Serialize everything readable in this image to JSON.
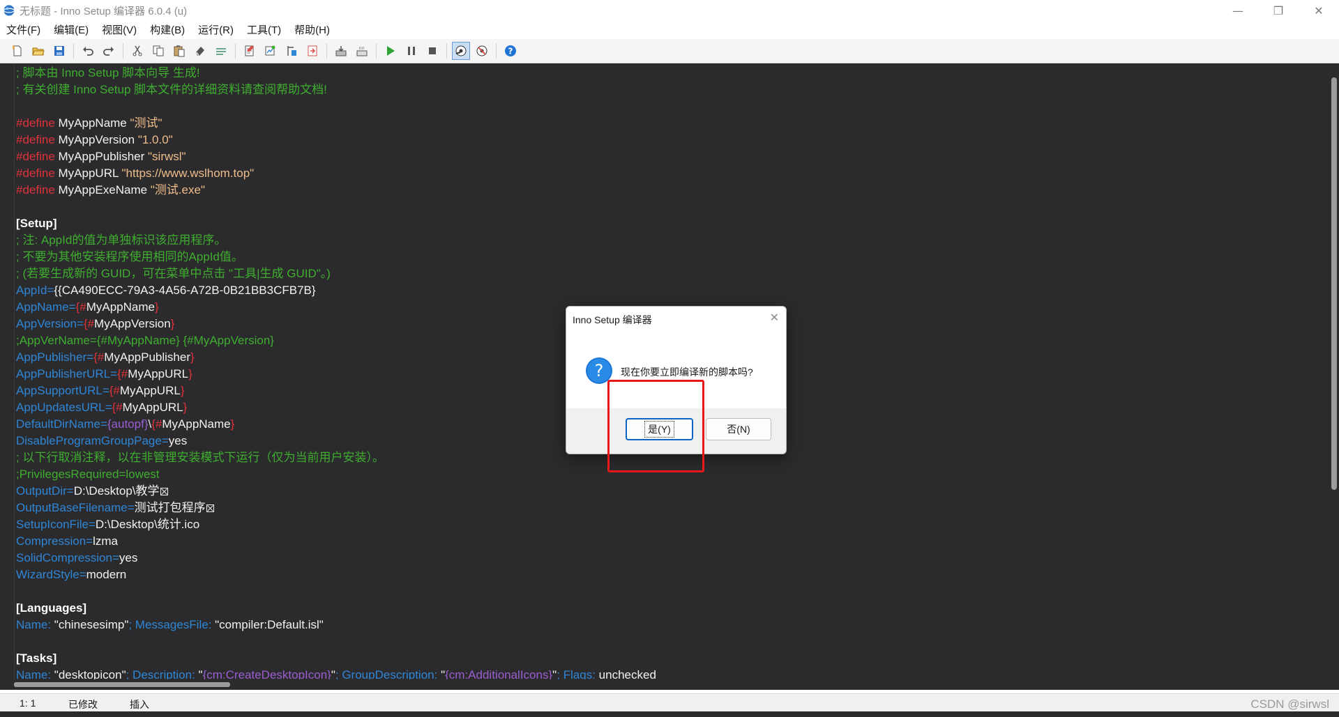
{
  "window": {
    "title": "无标题 - Inno Setup 编译器 6.0.4 (u)",
    "minimize_glyph": "—",
    "restore_glyph": "❐",
    "close_glyph": "✕"
  },
  "menu": [
    "文件(F)",
    "编辑(E)",
    "视图(V)",
    "构建(B)",
    "运行(R)",
    "工具(T)",
    "帮助(H)"
  ],
  "toolbar": {
    "icons": [
      "new-file-icon",
      "open-file-icon",
      "save-icon",
      "undo-icon",
      "redo-icon",
      "cut-icon",
      "copy-icon",
      "paste-icon",
      "erase-icon",
      "find-icon",
      "find-in-files-icon",
      "replace-icon",
      "goto-icon",
      "stop-icon",
      "compile-icon",
      "compile-all-icon",
      "run-icon",
      "pause-icon",
      "stop-run-icon",
      "target-setup-icon",
      "target-uninstall-icon",
      "help-icon"
    ]
  },
  "editor": {
    "lines": [
      [
        {
          "c": "cm",
          "t": "; 脚本由 Inno Setup 脚本向导 生成!"
        }
      ],
      [
        {
          "c": "cm",
          "t": "; 有关创建 Inno Setup 脚本文件的详细资料请查阅帮助文档!"
        }
      ],
      [],
      [
        {
          "c": "pp",
          "t": "#define"
        },
        {
          "c": "tx",
          "t": " MyAppName "
        },
        {
          "c": "nb",
          "t": "\"测试\""
        }
      ],
      [
        {
          "c": "pp",
          "t": "#define"
        },
        {
          "c": "tx",
          "t": " MyAppVersion "
        },
        {
          "c": "nb",
          "t": "\"1.0.0\""
        }
      ],
      [
        {
          "c": "pp",
          "t": "#define"
        },
        {
          "c": "tx",
          "t": " MyAppPublisher "
        },
        {
          "c": "nb",
          "t": "\"sirwsl\""
        }
      ],
      [
        {
          "c": "pp",
          "t": "#define"
        },
        {
          "c": "tx",
          "t": " MyAppURL "
        },
        {
          "c": "nb",
          "t": "\"https://www.wslhom.top\""
        }
      ],
      [
        {
          "c": "pp",
          "t": "#define"
        },
        {
          "c": "tx",
          "t": " MyAppExeName "
        },
        {
          "c": "nb",
          "t": "\"测试.exe\""
        }
      ],
      [],
      [
        {
          "c": "hd",
          "t": "[Setup]"
        }
      ],
      [
        {
          "c": "cm",
          "t": "; 注: AppId的值为单独标识该应用程序。"
        }
      ],
      [
        {
          "c": "cm",
          "t": "; 不要为其他安装程序使用相同的AppId值。"
        }
      ],
      [
        {
          "c": "cm",
          "t": "; (若要生成新的 GUID，可在菜单中点击 \"工具|生成 GUID\"。)"
        }
      ],
      [
        {
          "c": "kw",
          "t": "AppId"
        },
        {
          "c": "op",
          "t": "="
        },
        {
          "c": "vv",
          "t": "{{CA490ECC-79A3-4A56-A72B-0B21BB3CFB7B}"
        }
      ],
      [
        {
          "c": "kw",
          "t": "AppName"
        },
        {
          "c": "op",
          "t": "="
        },
        {
          "c": "br",
          "t": "{#"
        },
        {
          "c": "vv",
          "t": "MyAppName"
        },
        {
          "c": "br",
          "t": "}"
        }
      ],
      [
        {
          "c": "kw",
          "t": "AppVersion"
        },
        {
          "c": "op",
          "t": "="
        },
        {
          "c": "br",
          "t": "{#"
        },
        {
          "c": "vv",
          "t": "MyAppVersion"
        },
        {
          "c": "br",
          "t": "}"
        }
      ],
      [
        {
          "c": "cm",
          "t": ";AppVerName={#MyAppName} {#MyAppVersion}"
        }
      ],
      [
        {
          "c": "kw",
          "t": "AppPublisher"
        },
        {
          "c": "op",
          "t": "="
        },
        {
          "c": "br",
          "t": "{#"
        },
        {
          "c": "vv",
          "t": "MyAppPublisher"
        },
        {
          "c": "br",
          "t": "}"
        }
      ],
      [
        {
          "c": "kw",
          "t": "AppPublisherURL"
        },
        {
          "c": "op",
          "t": "="
        },
        {
          "c": "br",
          "t": "{#"
        },
        {
          "c": "vv",
          "t": "MyAppURL"
        },
        {
          "c": "br",
          "t": "}"
        }
      ],
      [
        {
          "c": "kw",
          "t": "AppSupportURL"
        },
        {
          "c": "op",
          "t": "="
        },
        {
          "c": "br",
          "t": "{#"
        },
        {
          "c": "vv",
          "t": "MyAppURL"
        },
        {
          "c": "br",
          "t": "}"
        }
      ],
      [
        {
          "c": "kw",
          "t": "AppUpdatesURL"
        },
        {
          "c": "op",
          "t": "="
        },
        {
          "c": "br",
          "t": "{#"
        },
        {
          "c": "vv",
          "t": "MyAppURL"
        },
        {
          "c": "br",
          "t": "}"
        }
      ],
      [
        {
          "c": "kw",
          "t": "DefaultDirName"
        },
        {
          "c": "op",
          "t": "="
        },
        {
          "c": "pu",
          "t": "{autopf}"
        },
        {
          "c": "vv",
          "t": "\\"
        },
        {
          "c": "br",
          "t": "{#"
        },
        {
          "c": "vv",
          "t": "MyAppName"
        },
        {
          "c": "br",
          "t": "}"
        }
      ],
      [
        {
          "c": "kw",
          "t": "DisableProgramGroupPage"
        },
        {
          "c": "op",
          "t": "="
        },
        {
          "c": "vv",
          "t": "yes"
        }
      ],
      [
        {
          "c": "cm",
          "t": "; 以下行取消注释，以在非管理安装模式下运行（仅为当前用户安装）。"
        }
      ],
      [
        {
          "c": "cm",
          "t": ";PrivilegesRequired=lowest"
        }
      ],
      [
        {
          "c": "kw",
          "t": "OutputDir"
        },
        {
          "c": "op",
          "t": "="
        },
        {
          "c": "vv",
          "t": "D:\\Desktop\\教学"
        },
        {
          "c": "box",
          "t": ""
        }
      ],
      [
        {
          "c": "kw",
          "t": "OutputBaseFilename"
        },
        {
          "c": "op",
          "t": "="
        },
        {
          "c": "vv",
          "t": "测试打包程序"
        },
        {
          "c": "box",
          "t": ""
        }
      ],
      [
        {
          "c": "kw",
          "t": "SetupIconFile"
        },
        {
          "c": "op",
          "t": "="
        },
        {
          "c": "vv",
          "t": "D:\\Desktop\\统计.ico"
        }
      ],
      [
        {
          "c": "kw",
          "t": "Compression"
        },
        {
          "c": "op",
          "t": "="
        },
        {
          "c": "vv",
          "t": "lzma"
        }
      ],
      [
        {
          "c": "kw",
          "t": "SolidCompression"
        },
        {
          "c": "op",
          "t": "="
        },
        {
          "c": "vv",
          "t": "yes"
        }
      ],
      [
        {
          "c": "kw",
          "t": "WizardStyle"
        },
        {
          "c": "op",
          "t": "="
        },
        {
          "c": "vv",
          "t": "modern"
        }
      ],
      [],
      [
        {
          "c": "hd",
          "t": "[Languages]"
        }
      ],
      [
        {
          "c": "kw",
          "t": "Name:"
        },
        {
          "c": "vv",
          "t": " \"chinesesimp\""
        },
        {
          "c": "kw",
          "t": "; MessagesFile:"
        },
        {
          "c": "vv",
          "t": " \"compiler:Default.isl\""
        }
      ],
      [],
      [
        {
          "c": "hd",
          "t": "[Tasks]"
        }
      ],
      [
        {
          "c": "kw",
          "t": "Name:"
        },
        {
          "c": "vv",
          "t": " \"desktopicon\""
        },
        {
          "c": "kw",
          "t": "; Description:"
        },
        {
          "c": "vv",
          "t": " \""
        },
        {
          "c": "pu",
          "t": "{cm:CreateDesktopIcon}"
        },
        {
          "c": "vv",
          "t": "\""
        },
        {
          "c": "kw",
          "t": "; GroupDescription:"
        },
        {
          "c": "vv",
          "t": " \""
        },
        {
          "c": "pu",
          "t": "{cm:AdditionalIcons}"
        },
        {
          "c": "vv",
          "t": "\""
        },
        {
          "c": "kw",
          "t": "; Flags:"
        },
        {
          "c": "vv",
          "t": " unchecked"
        }
      ]
    ]
  },
  "status": {
    "position": "1:   1",
    "modified": "已修改",
    "mode": "插入"
  },
  "watermark": "CSDN @sirwsl",
  "dialog": {
    "title": "Inno Setup 编译器",
    "close_glyph": "✕",
    "message": "现在你要立即编译新的脚本吗?",
    "yes_label": "是(Y)",
    "no_label": "否(N)"
  }
}
